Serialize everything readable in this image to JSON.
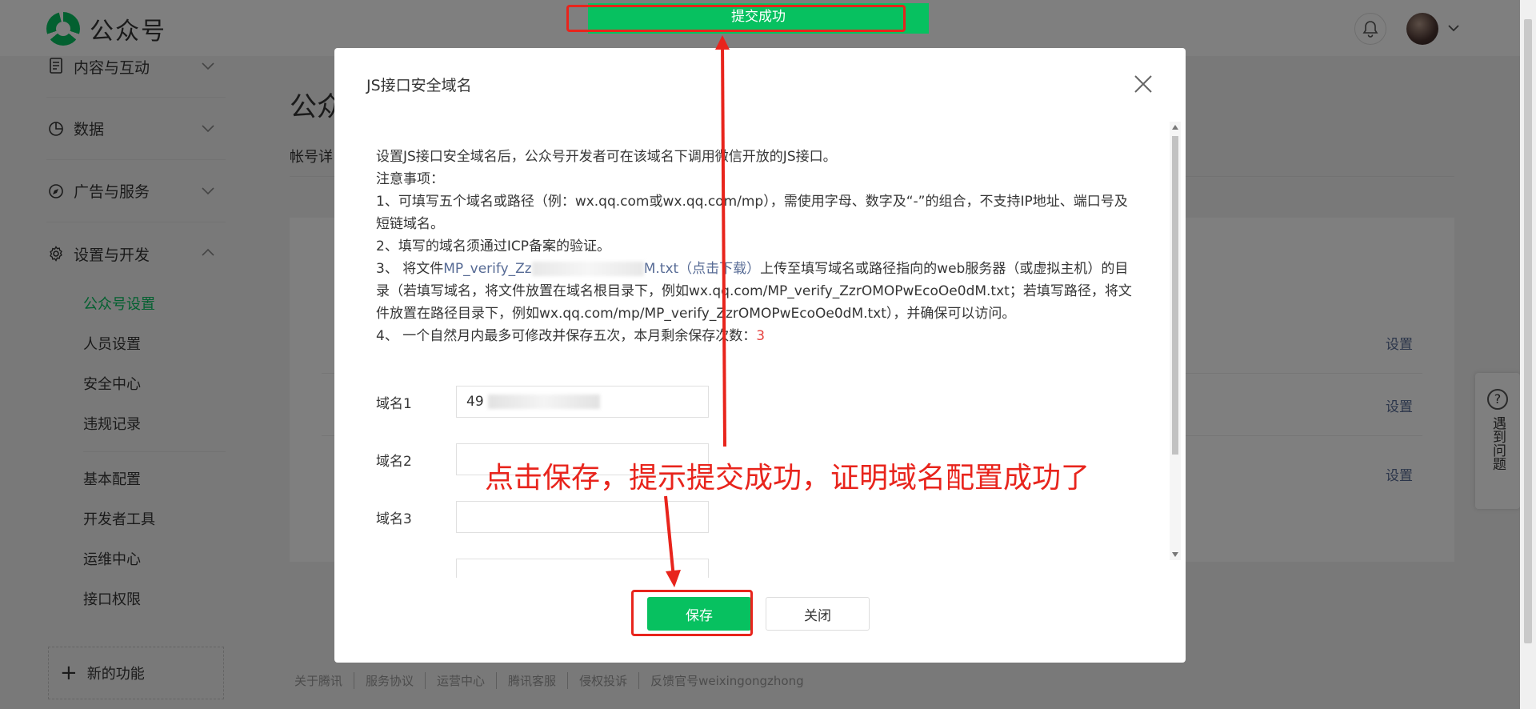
{
  "header": {
    "logo_text": "公众号",
    "icons": [
      "logo-icon",
      "bell-icon",
      "avatar",
      "chevron-down-icon"
    ]
  },
  "sidebar": {
    "sections": [
      {
        "label": "内容与互动",
        "icon": "document-icon",
        "expanded": false
      },
      {
        "label": "数据",
        "icon": "pie-chart-icon",
        "expanded": false
      },
      {
        "label": "广告与服务",
        "icon": "compass-icon",
        "expanded": false
      },
      {
        "label": "设置与开发",
        "icon": "gear-icon",
        "expanded": true
      }
    ],
    "sub_items_group1": [
      "公众号设置",
      "人员设置",
      "安全中心",
      "违规记录"
    ],
    "sub_items_group2": [
      "基本配置",
      "开发者工具",
      "运维中心",
      "接口权限"
    ],
    "active_item": "公众号设置",
    "new_feature": "新的功能"
  },
  "main": {
    "title_partial": "公众",
    "tab_partial": "帐号详",
    "row_actions": [
      "设置",
      "设置",
      "设置"
    ]
  },
  "footer": {
    "links": [
      "关于腾讯",
      "服务协议",
      "运营中心",
      "腾讯客服",
      "侵权投诉",
      "反馈官号weixingongzhong"
    ]
  },
  "help_widget": {
    "label": "遇到问题",
    "icon": "question-icon"
  },
  "toast": {
    "text": "提交成功"
  },
  "dialog": {
    "title": "JS接口安全域名",
    "intro": "设置JS接口安全域名后，公众号开发者可在该域名下调用微信开放的JS接口。",
    "notes_title": "注意事项：",
    "note1": "1、可填写五个域名或路径（例：wx.qq.com或wx.qq.com/mp），需使用字母、数字及“-”的组合，不支持IP地址、端口号及短链域名。",
    "note2": "2、填写的域名须通过ICP备案的验证。",
    "note3_prefix": "3、 将文件",
    "note3_file_start": "MP_verify_Zz",
    "note3_file_end": "M.txt（点击下载）",
    "note3_rest": "上传至填写域名或路径指向的web服务器（或虚拟主机）的目录（若填写域名，将文件放置在域名根目录下，例如wx.qq.com/MP_verify_ZzrOMOPwEcoOe0dM.txt；若填写路径，将文件放置在路径目录下，例如wx.qq.com/mp/MP_verify_ZzrOMOPwEcoOe0dM.txt），并确保可以访问。",
    "note4_prefix": "4、 一个自然月内最多可修改并保存五次，本月剩余保存次数：",
    "note4_count": "3",
    "domains": [
      {
        "label": "域名1",
        "value": "49"
      },
      {
        "label": "域名2",
        "value": ""
      },
      {
        "label": "域名3",
        "value": ""
      }
    ],
    "save_label": "保存",
    "close_label": "关闭",
    "close_icon": "close-icon"
  },
  "annotation": {
    "text": "点击保存，提示提交成功，证明域名配置成功了",
    "color": "#e8241c"
  },
  "colors": {
    "brand": "#07c160",
    "link": "#576b95",
    "warning": "#e64340"
  }
}
